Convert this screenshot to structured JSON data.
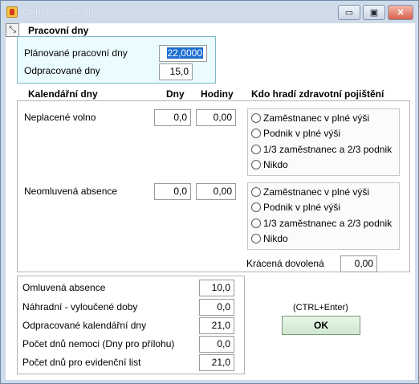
{
  "window": {
    "title": "Odpracované dny",
    "controls": {
      "minimize": "▭",
      "maximize": "▣",
      "close": "✕"
    }
  },
  "colors": {
    "selection": "#1c6dd0",
    "panel_highlight": "#eafcff",
    "ok_button": "#cfe7cf"
  },
  "work_days": {
    "heading": "Pracovní dny",
    "planned_label": "Plánované pracovní dny",
    "planned_value": "22,0000",
    "worked_label": "Odpracované dny",
    "worked_value": "15,0"
  },
  "calendar": {
    "heading": "Kalendářní dny",
    "col_days": "Dny",
    "col_hours": "Hodiny",
    "col_insurance": "Kdo hradí zdravotní pojištění",
    "unpaid_leave": {
      "label": "Neplacené  volno",
      "days": "0,0",
      "hours": "0,00",
      "options": [
        "Zaměstnanec v plné výši",
        "Podnik v plné výši",
        "1/3 zaměstnanec a 2/3 podnik",
        "Nikdo"
      ]
    },
    "unexcused_absence": {
      "label": "Neomluvená absence",
      "days": "0,0",
      "hours": "0,00",
      "options": [
        "Zaměstnanec v plné výši",
        "Podnik v plné výši",
        "1/3 zaměstnanec a 2/3 podnik",
        "Nikdo"
      ]
    },
    "reduced_leave_label": "Krácená dovolená",
    "reduced_leave_value": "0,00"
  },
  "summary": {
    "rows": [
      {
        "label": "Omluvená absence",
        "value": "10,0"
      },
      {
        "label": "Náhradní - vyloučené doby",
        "value": "0,0"
      },
      {
        "label": "Odpracované kalendářní dny",
        "value": "21,0"
      },
      {
        "label": "Počet dnů nemoci (Dny pro přílohu)",
        "value": "0,0"
      },
      {
        "label": "Počet dnů pro evidenční list",
        "value": "21,0"
      }
    ]
  },
  "actions": {
    "shortcut_hint": "(CTRL+Enter)",
    "ok_label": "OK"
  }
}
